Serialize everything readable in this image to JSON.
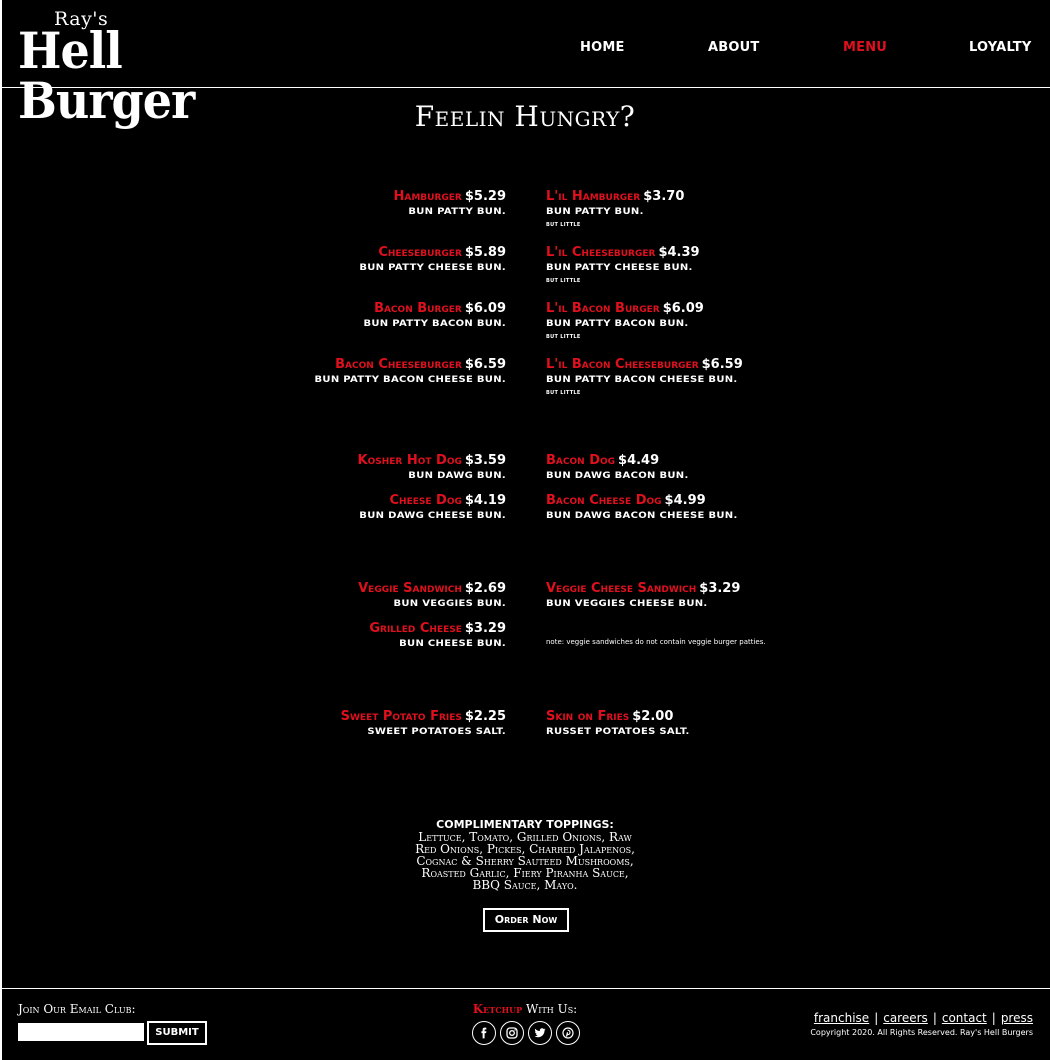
{
  "brand": {
    "logo_top": "Ray's",
    "logo_main": "Hell Burger"
  },
  "nav": {
    "home": "HOME",
    "about": "ABOUT",
    "menu": "MENU",
    "loyalty": "LOYALTY"
  },
  "title": "Feelin Hungry?",
  "menu": {
    "burgers_left": [
      {
        "name": "Hamburger",
        "price": "$5.29",
        "desc": "bun patty bun."
      },
      {
        "name": "Cheeseburger",
        "price": "$5.89",
        "desc": "bun patty cheese bun."
      },
      {
        "name": "Bacon Burger",
        "price": "$6.09",
        "desc": "bun patty bacon bun."
      },
      {
        "name": "Bacon Cheeseburger",
        "price": "$6.59",
        "desc": "bun patty bacon cheese bun."
      }
    ],
    "burgers_right": [
      {
        "name": "L'il Hamburger",
        "price": "$3.70",
        "desc": "bun patty bun.",
        "note": "but little"
      },
      {
        "name": "L'il Cheeseburger",
        "price": "$4.39",
        "desc": "bun patty cheese bun.",
        "note": "but little"
      },
      {
        "name": "L'il Bacon Burger",
        "price": "$6.09",
        "desc": "bun patty bacon bun.",
        "note": "but little"
      },
      {
        "name": "L'il Bacon Cheeseburger",
        "price": "$6.59",
        "desc": "bun patty bacon cheese bun.",
        "note": "but little"
      }
    ],
    "dogs_left": [
      {
        "name": "Kosher Hot Dog",
        "price": "$3.59",
        "desc": "bun dawg bun."
      },
      {
        "name": "Cheese Dog",
        "price": "$4.19",
        "desc": "bun dawg cheese bun."
      }
    ],
    "dogs_right": [
      {
        "name": "Bacon Dog",
        "price": "$4.49",
        "desc": "bun dawg bacon bun."
      },
      {
        "name": "Bacon Cheese Dog",
        "price": "$4.99",
        "desc": "bun dawg bacon cheese bun."
      }
    ],
    "veggie_left": [
      {
        "name": "Veggie Sandwich",
        "price": "$2.69",
        "desc": "bun veggies bun."
      },
      {
        "name": "Grilled Cheese",
        "price": "$3.29",
        "desc": "bun cheese bun."
      }
    ],
    "veggie_right": [
      {
        "name": "Veggie Cheese Sandwich",
        "price": "$3.29",
        "desc": "bun veggies cheese bun."
      }
    ],
    "veggie_note": "note: veggie sandwiches do not contain veggie burger patties.",
    "fries_left": [
      {
        "name": "Sweet Potato Fries",
        "price": "$2.25",
        "desc": "sweet potatoes salt."
      }
    ],
    "fries_right": [
      {
        "name": "Skin on Fries",
        "price": "$2.00",
        "desc": "russet potatoes salt."
      }
    ]
  },
  "toppings": {
    "title": "Complimentary toppings:",
    "lines": [
      "Lettuce, Tomato, Grilled Onions, Raw",
      "Red Onions, Pickes, Charred Jalapenos,",
      "Cognac & Sherry Sauteed Mushrooms,",
      "Roasted Garlic, Fiery Piranha Sauce,",
      "BBQ Sauce, Mayo."
    ]
  },
  "order_button": "Order Now",
  "footer": {
    "email_label": "Join Our Email Club:",
    "email_value": "",
    "submit_label": "Submit",
    "ketchup_red": "Ketchup",
    "ketchup_rest": " With Us:",
    "socials": [
      "facebook-icon",
      "instagram-icon",
      "twitter-icon",
      "pinterest-icon"
    ],
    "links": [
      "franchise",
      "careers",
      "contact",
      "press"
    ],
    "copyright": "Copyright 2020. All Rights Reserved. Ray's Hell Burgers"
  },
  "colors": {
    "accent": "#e0101e",
    "background": "#000000",
    "text": "#ffffff"
  }
}
